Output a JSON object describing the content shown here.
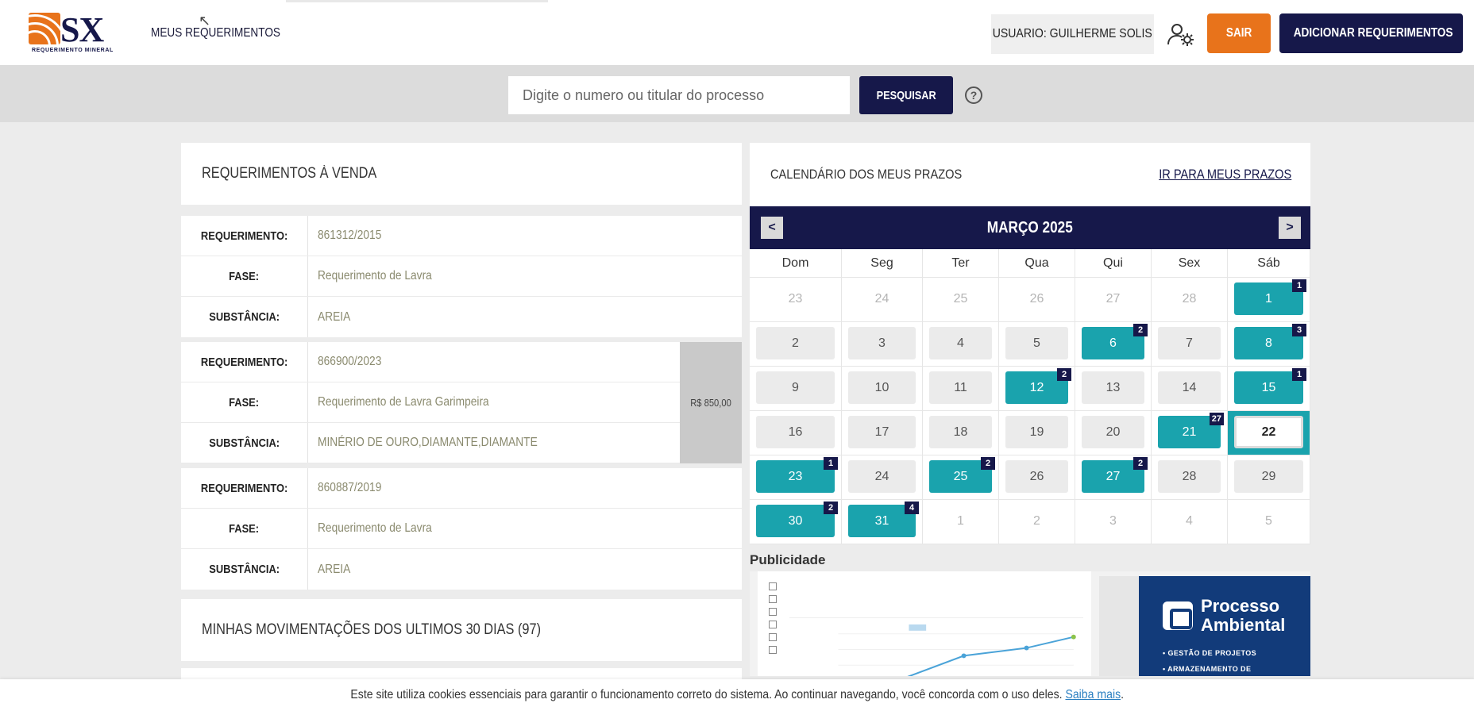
{
  "header": {
    "logo_text": "SX",
    "logo_sub": "REQUERIMENTO MINERAL",
    "nav_link": "MEUS REQUERIMENTOS",
    "user_label": "USUARIO: GUILHERME SOLIS",
    "logout_label": "SAIR",
    "add_label": "ADICIONAR REQUERIMENTOS"
  },
  "search": {
    "placeholder": "Digite o numero ou titular do processo",
    "button_label": "PESQUISAR",
    "help_glyph": "?"
  },
  "sale_panel": {
    "title": "REQUERIMENTOS À VENDA",
    "cards": [
      {
        "requerimento": "861312/2015",
        "fase": "Requerimento de Lavra",
        "substancia": "AREIA",
        "price": ""
      },
      {
        "requerimento": "866900/2023",
        "fase": "Requerimento de Lavra Garimpeira",
        "substancia": "MINÉRIO DE OURO,DIAMANTE,DIAMANTE",
        "price": "R$ 850,00"
      },
      {
        "requerimento": "860887/2019",
        "fase": "Requerimento de Lavra",
        "substancia": "AREIA",
        "price": ""
      }
    ],
    "labels": {
      "requerimento": "REQUERIMENTO:",
      "fase": "FASE:",
      "substancia": "SUBSTÂNCIA:"
    }
  },
  "movements_panel": {
    "title": "MINHAS MOVIMENTAÇÕES DOS ULTIMOS 30 DIAS (97)"
  },
  "calendar": {
    "title": "CALENDÁRIO DOS MEUS PRAZOS",
    "link": "IR PARA MEUS PRAZOS",
    "month": "MARÇO 2025",
    "prev": "<",
    "next": ">",
    "weekdays": [
      "Dom",
      "Seg",
      "Ter",
      "Qua",
      "Qui",
      "Sex",
      "Sáb"
    ],
    "weeks": [
      [
        {
          "d": "23",
          "s": "out"
        },
        {
          "d": "24",
          "s": "out"
        },
        {
          "d": "25",
          "s": "out"
        },
        {
          "d": "26",
          "s": "out"
        },
        {
          "d": "27",
          "s": "out"
        },
        {
          "d": "28",
          "s": "out"
        },
        {
          "d": "1",
          "s": "evt",
          "b": "1"
        }
      ],
      [
        {
          "d": "2",
          "s": "norm"
        },
        {
          "d": "3",
          "s": "norm"
        },
        {
          "d": "4",
          "s": "norm"
        },
        {
          "d": "5",
          "s": "norm"
        },
        {
          "d": "6",
          "s": "evt",
          "b": "2"
        },
        {
          "d": "7",
          "s": "norm"
        },
        {
          "d": "8",
          "s": "evt",
          "b": "3"
        }
      ],
      [
        {
          "d": "9",
          "s": "norm"
        },
        {
          "d": "10",
          "s": "norm"
        },
        {
          "d": "11",
          "s": "norm"
        },
        {
          "d": "12",
          "s": "evt",
          "b": "2"
        },
        {
          "d": "13",
          "s": "norm"
        },
        {
          "d": "14",
          "s": "norm"
        },
        {
          "d": "15",
          "s": "evt",
          "b": "1"
        }
      ],
      [
        {
          "d": "16",
          "s": "norm"
        },
        {
          "d": "17",
          "s": "norm"
        },
        {
          "d": "18",
          "s": "norm"
        },
        {
          "d": "19",
          "s": "norm"
        },
        {
          "d": "20",
          "s": "norm"
        },
        {
          "d": "21",
          "s": "evt",
          "b": "27"
        },
        {
          "d": "22",
          "s": "today"
        }
      ],
      [
        {
          "d": "23",
          "s": "evt",
          "b": "1"
        },
        {
          "d": "24",
          "s": "norm"
        },
        {
          "d": "25",
          "s": "evt",
          "b": "2"
        },
        {
          "d": "26",
          "s": "norm"
        },
        {
          "d": "27",
          "s": "evt",
          "b": "2"
        },
        {
          "d": "28",
          "s": "norm"
        },
        {
          "d": "29",
          "s": "norm"
        }
      ],
      [
        {
          "d": "30",
          "s": "evt",
          "b": "2"
        },
        {
          "d": "31",
          "s": "evt",
          "b": "4"
        },
        {
          "d": "1",
          "s": "out"
        },
        {
          "d": "2",
          "s": "out"
        },
        {
          "d": "3",
          "s": "out"
        },
        {
          "d": "4",
          "s": "out"
        },
        {
          "d": "5",
          "s": "out"
        }
      ]
    ]
  },
  "ad": {
    "label": "Publicidade",
    "title_line1": "Processo",
    "title_line2": "Ambiental",
    "items": [
      "• GESTÃO DE PROJETOS",
      "• ARMAZENAMENTO DE"
    ]
  },
  "cookie": {
    "text": "Este site utiliza cookies essenciais para garantir o funcionamento correto do sistema. Ao continuar navegando, você concorda com o uso deles.",
    "link": "Saiba mais",
    "trail": "."
  },
  "colors": {
    "brand_navy": "#16184a",
    "brand_orange": "#e8731b",
    "event_teal": "#1aa3ad"
  },
  "icons": {
    "user_settings": "user-gear-icon",
    "help": "help-circle-icon"
  }
}
